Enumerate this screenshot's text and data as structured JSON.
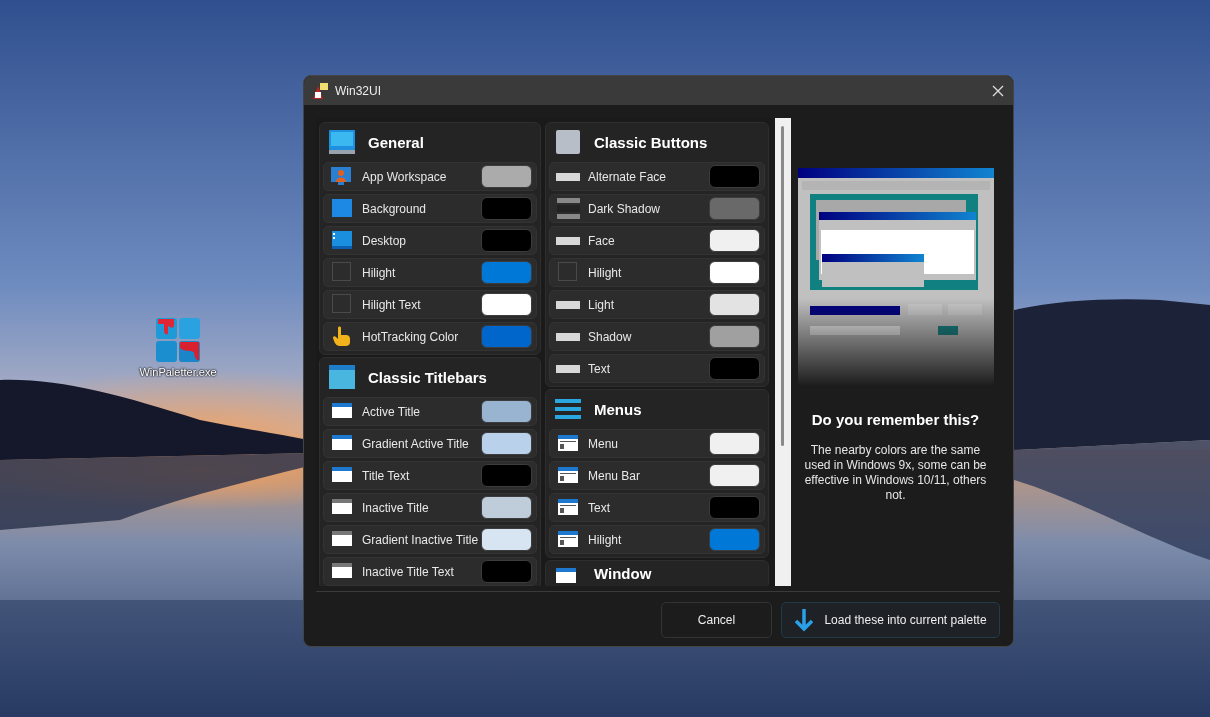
{
  "desktop_icons": [
    {
      "label": "WinPaletter.exe"
    }
  ],
  "window": {
    "title": "Win32UI"
  },
  "columns": [
    [
      {
        "title": "General",
        "kind": "monitor",
        "rows": [
          {
            "label": "App Workspace",
            "kind": "person-monitor",
            "color": "#ababab"
          },
          {
            "label": "Background",
            "kind": "blue-square",
            "color": "#000000"
          },
          {
            "label": "Desktop",
            "kind": "desktop",
            "color": "#000000"
          },
          {
            "label": "Hilight",
            "kind": "empty",
            "color": "#0078d7"
          },
          {
            "label": "Hilight Text",
            "kind": "empty",
            "color": "#ffffff"
          },
          {
            "label": "HotTracking Color",
            "kind": "hand",
            "color": "#0066cc"
          }
        ]
      },
      {
        "title": "Classic Titlebars",
        "kind": "window-cyan",
        "rows": [
          {
            "label": "Active Title",
            "kind": "window-active",
            "color": "#99b4d1"
          },
          {
            "label": "Gradient Active Title",
            "kind": "window-active",
            "color": "#b9d1ea"
          },
          {
            "label": "Title Text",
            "kind": "window-active",
            "color": "#000000"
          },
          {
            "label": "Inactive Title",
            "kind": "window-inactive",
            "color": "#bfcddb"
          },
          {
            "label": "Gradient Inactive Title",
            "kind": "window-inactive",
            "color": "#d7e4f2"
          },
          {
            "label": "Inactive Title Text",
            "kind": "window-inactive",
            "color": "#000000"
          }
        ]
      }
    ],
    [
      {
        "title": "Classic Buttons",
        "kind": "gray-square",
        "rows": [
          {
            "label": "Alternate Face",
            "kind": "bar",
            "color": "#000000"
          },
          {
            "label": "Dark Shadow",
            "kind": "shadow-bar",
            "color": "#696969"
          },
          {
            "label": "Face",
            "kind": "bar",
            "color": "#f0f0f0"
          },
          {
            "label": "Hilight",
            "kind": "empty",
            "color": "#ffffff"
          },
          {
            "label": "Light",
            "kind": "bar",
            "color": "#e3e3e3"
          },
          {
            "label": "Shadow",
            "kind": "bar",
            "color": "#a0a0a0"
          },
          {
            "label": "Text",
            "kind": "bar",
            "color": "#000000"
          }
        ]
      },
      {
        "title": "Menus",
        "kind": "lines",
        "rows": [
          {
            "label": "Menu",
            "kind": "menu-window",
            "color": "#f0f0f0"
          },
          {
            "label": "Menu Bar",
            "kind": "menu-window",
            "color": "#f0f0f0"
          },
          {
            "label": "Text",
            "kind": "menu-window",
            "color": "#000000"
          },
          {
            "label": "Hilight",
            "kind": "menu-window",
            "color": "#0078d7"
          }
        ]
      },
      {
        "title": "Window",
        "kind": "window-active"
      }
    ]
  ],
  "preview": {
    "kind": "picture"
  },
  "info": {
    "heading": "Do you remember this?",
    "text": "The nearby colors are the same used in Windows 9x, some can be effective in Windows 10/11, others not."
  },
  "buttons": [
    {
      "label": "Cancel",
      "kind": "plain"
    },
    {
      "label": "Load these into current palette",
      "kind": "download"
    }
  ]
}
